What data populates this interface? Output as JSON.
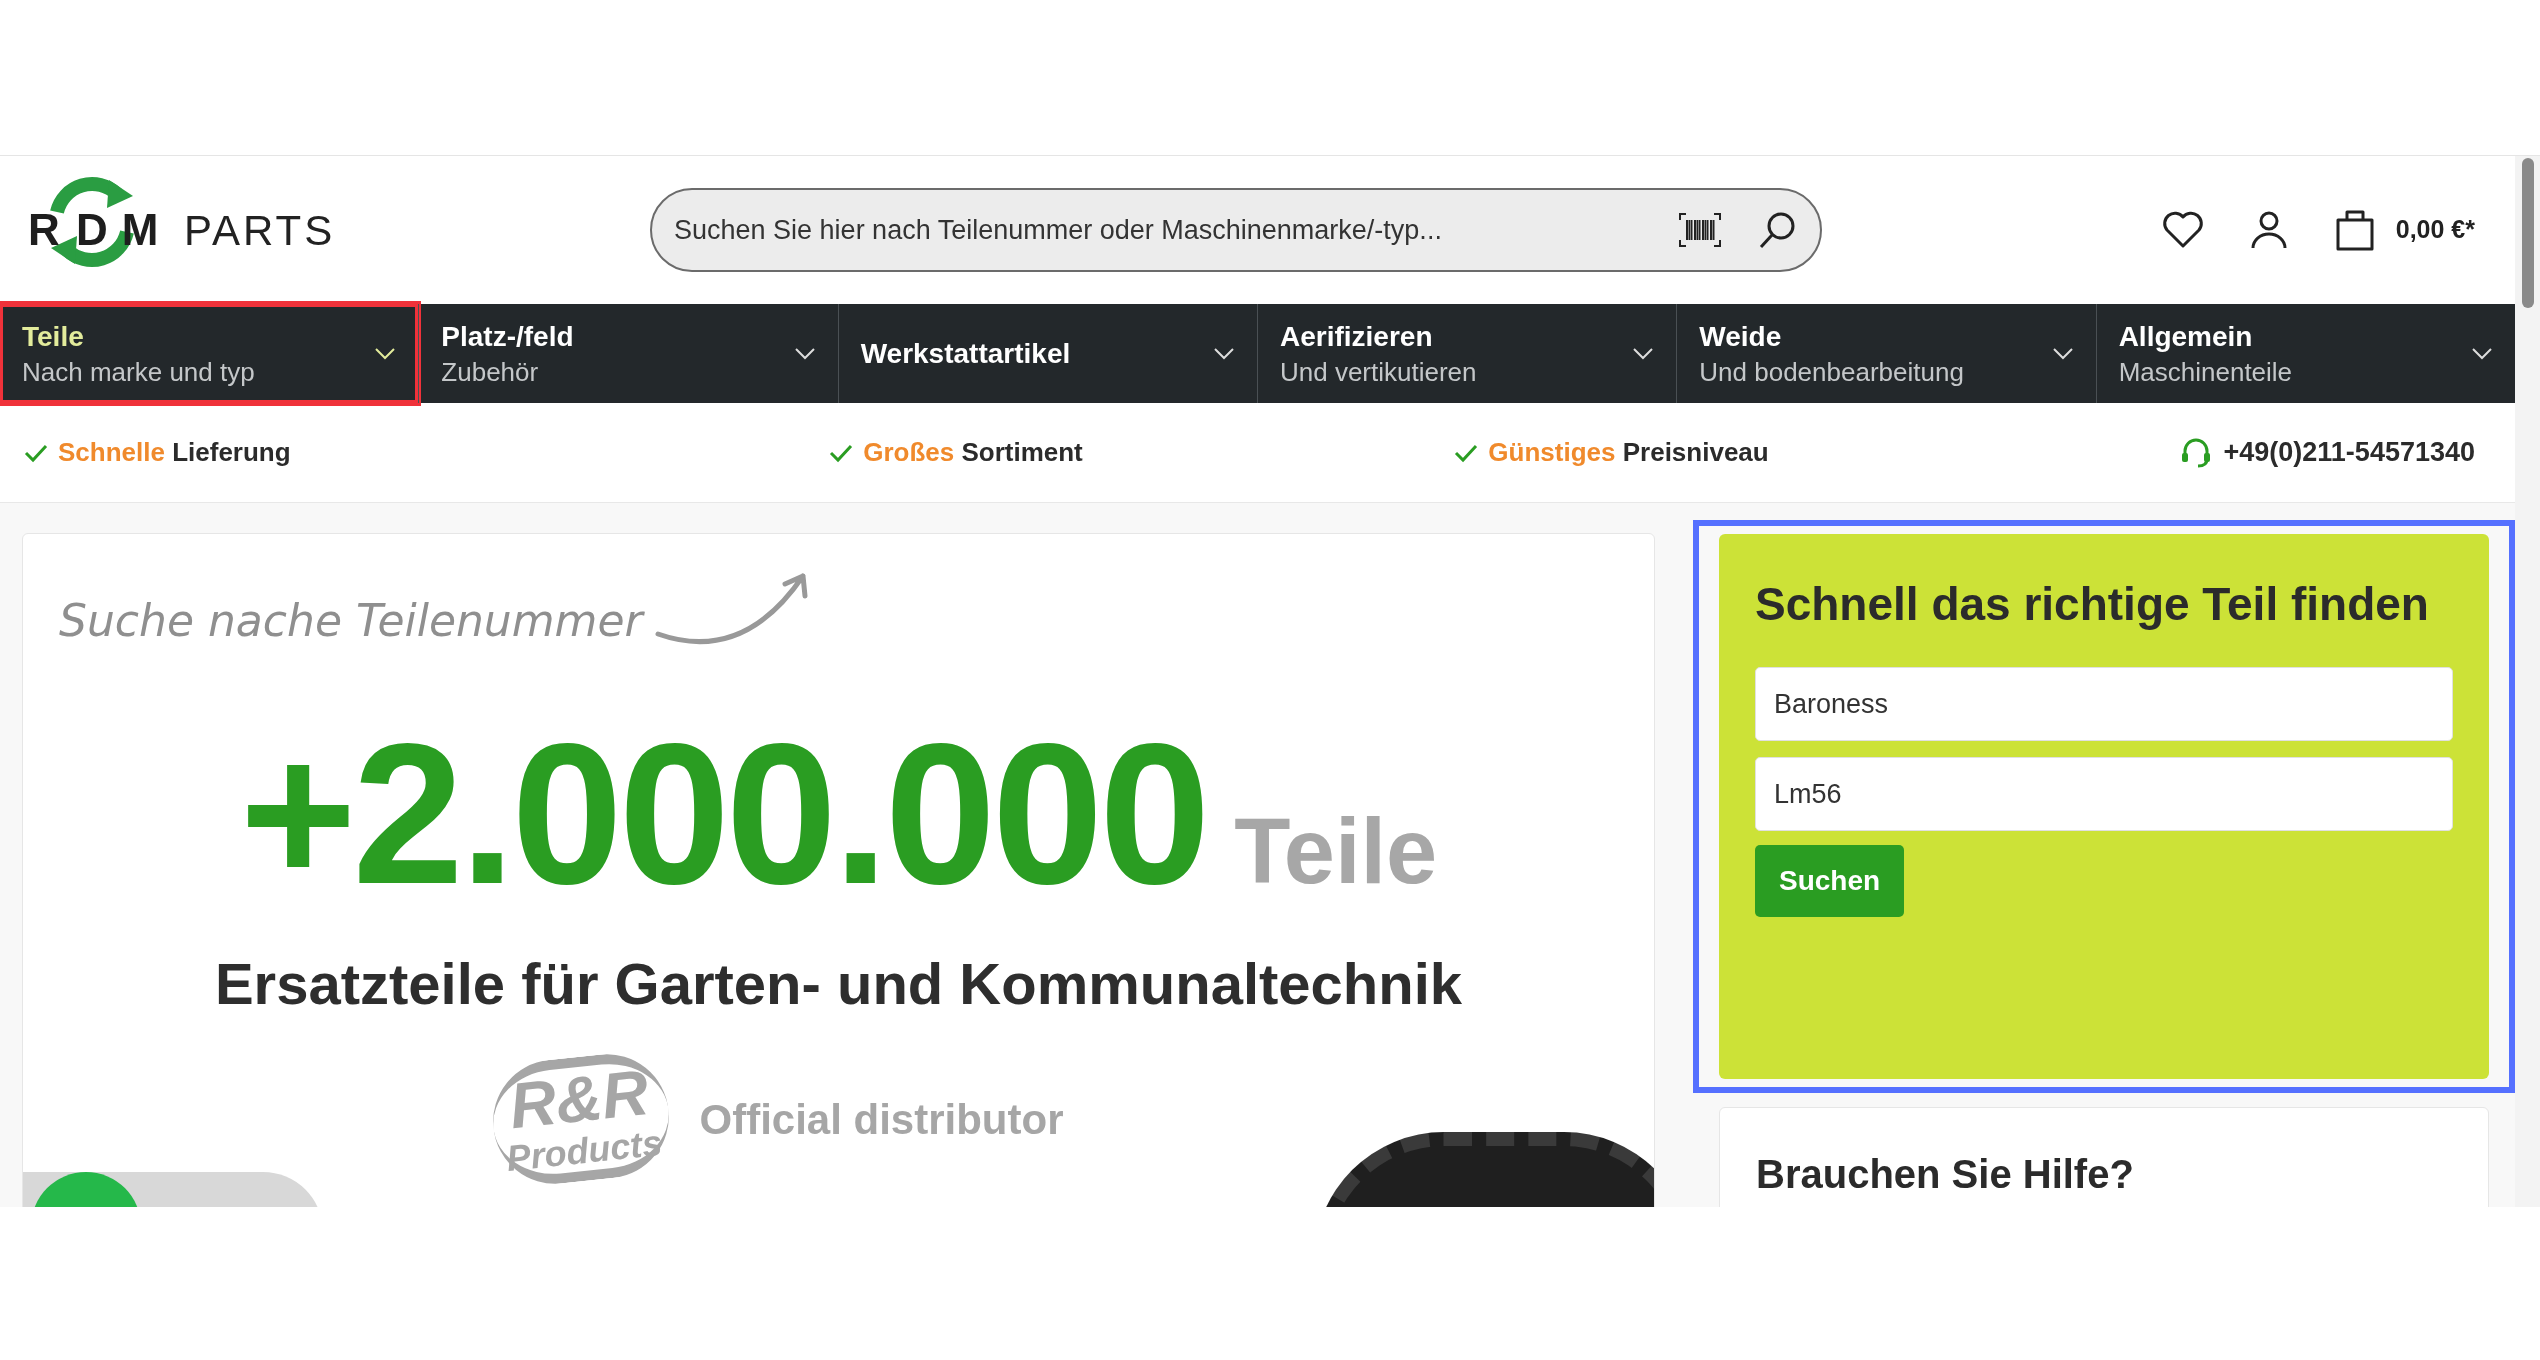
{
  "header": {
    "logo": {
      "letters": [
        "R",
        "D",
        "M"
      ],
      "word": "PARTS"
    },
    "search": {
      "placeholder": "Suchen Sie hier nach Teilenummer oder Maschinenmarke/-typ..."
    },
    "cart_total": "0,00 €*"
  },
  "nav": [
    {
      "title": "Teile",
      "subtitle": "Nach marke und typ",
      "selected": true
    },
    {
      "title": "Platz-/feld",
      "subtitle": "Zubehör",
      "selected": false
    },
    {
      "title": "Werkstattartikel",
      "selected": false
    },
    {
      "title": "Aerifizieren",
      "subtitle": "Und vertikutieren",
      "selected": false
    },
    {
      "title": "Weide",
      "subtitle": "Und bodenbearbeitung",
      "selected": false
    },
    {
      "title": "Allgemein",
      "subtitle": "Maschinenteile",
      "selected": false
    }
  ],
  "features": [
    {
      "highlight": "Schnelle",
      "text": "Lieferung"
    },
    {
      "highlight": "Großes",
      "text": "Sortiment"
    },
    {
      "highlight": "Günstiges",
      "text": "Preisniveau"
    }
  ],
  "phone": "+49(0)211-54571340",
  "banner": {
    "handwriting": "Suche nache Teilenummer",
    "count": "+2.000.000",
    "unit": "Teile",
    "tagline": "Ersatzteile für Garten- und Kommunaltechnik",
    "brand_logo": [
      "R&R",
      "Products"
    ],
    "brand_note": "Official distributor"
  },
  "finder": {
    "title": "Schnell das richtige Teil finden",
    "fields": [
      {
        "value": "Baroness"
      },
      {
        "value": "Lm56"
      }
    ],
    "button": "Suchen"
  },
  "help": {
    "title": "Brauchen Sie Hilfe?"
  }
}
